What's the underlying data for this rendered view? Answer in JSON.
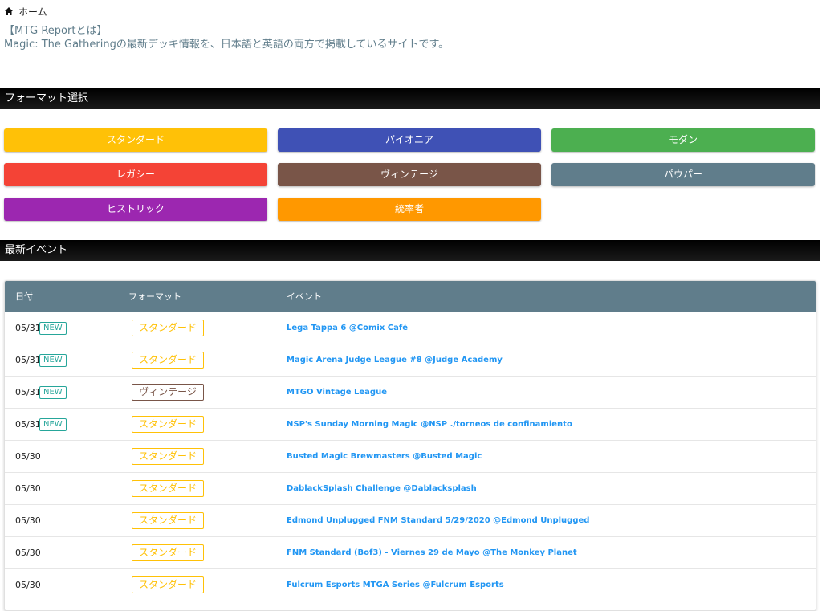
{
  "breadcrumb": {
    "home_label": "ホーム"
  },
  "intro": {
    "line1": "【MTG Reportとは】",
    "line2": "Magic: The Gatheringの最新デッキ情報を、日本語と英語の両方で掲載しているサイトです。"
  },
  "format_section": {
    "title": "フォーマット選択"
  },
  "formats": [
    {
      "label": "スタンダード",
      "color": "#ffc107"
    },
    {
      "label": "パイオニア",
      "color": "#3f51b5"
    },
    {
      "label": "モダン",
      "color": "#4caf50"
    },
    {
      "label": "レガシー",
      "color": "#f44336"
    },
    {
      "label": "ヴィンテージ",
      "color": "#795548"
    },
    {
      "label": "パウパー",
      "color": "#607d8b"
    },
    {
      "label": "ヒストリック",
      "color": "#9c27b0"
    },
    {
      "label": "統率者",
      "color": "#ff9800"
    }
  ],
  "events_section": {
    "title": "最新イベント"
  },
  "events_table": {
    "headers": {
      "date": "日付",
      "format": "フォーマット",
      "event": "イベント"
    },
    "rows": [
      {
        "date": "05/31",
        "badge": "NEW",
        "format": "スタンダード",
        "format_color": "#ffc107",
        "event": "Lega Tappa 6 @Comix Cafè"
      },
      {
        "date": "05/31",
        "badge": "NEW",
        "format": "スタンダード",
        "format_color": "#ffc107",
        "event": "Magic Arena Judge League #8 @Judge Academy"
      },
      {
        "date": "05/31",
        "badge": "NEW",
        "format": "ヴィンテージ",
        "format_color": "#795548",
        "event": "MTGO Vintage League"
      },
      {
        "date": "05/31",
        "badge": "NEW",
        "format": "スタンダード",
        "format_color": "#ffc107",
        "event": "NSP's Sunday Morning Magic @NSP ./torneos de confinamiento"
      },
      {
        "date": "05/30",
        "badge": "",
        "format": "スタンダード",
        "format_color": "#ffc107",
        "event": "Busted Magic Brewmasters @Busted Magic"
      },
      {
        "date": "05/30",
        "badge": "",
        "format": "スタンダード",
        "format_color": "#ffc107",
        "event": "DablackSplash Challenge @Dablacksplash"
      },
      {
        "date": "05/30",
        "badge": "",
        "format": "スタンダード",
        "format_color": "#ffc107",
        "event": "Edmond Unplugged FNM Standard 5/29/2020 @Edmond Unplugged"
      },
      {
        "date": "05/30",
        "badge": "",
        "format": "スタンダード",
        "format_color": "#ffc107",
        "event": "FNM Standard (Bof3) - Viernes 29 de Mayo @The Monkey Planet"
      },
      {
        "date": "05/30",
        "badge": "",
        "format": "スタンダード",
        "format_color": "#ffc107",
        "event": "Fulcrum Esports MTGA Series @Fulcrum Esports"
      }
    ]
  }
}
